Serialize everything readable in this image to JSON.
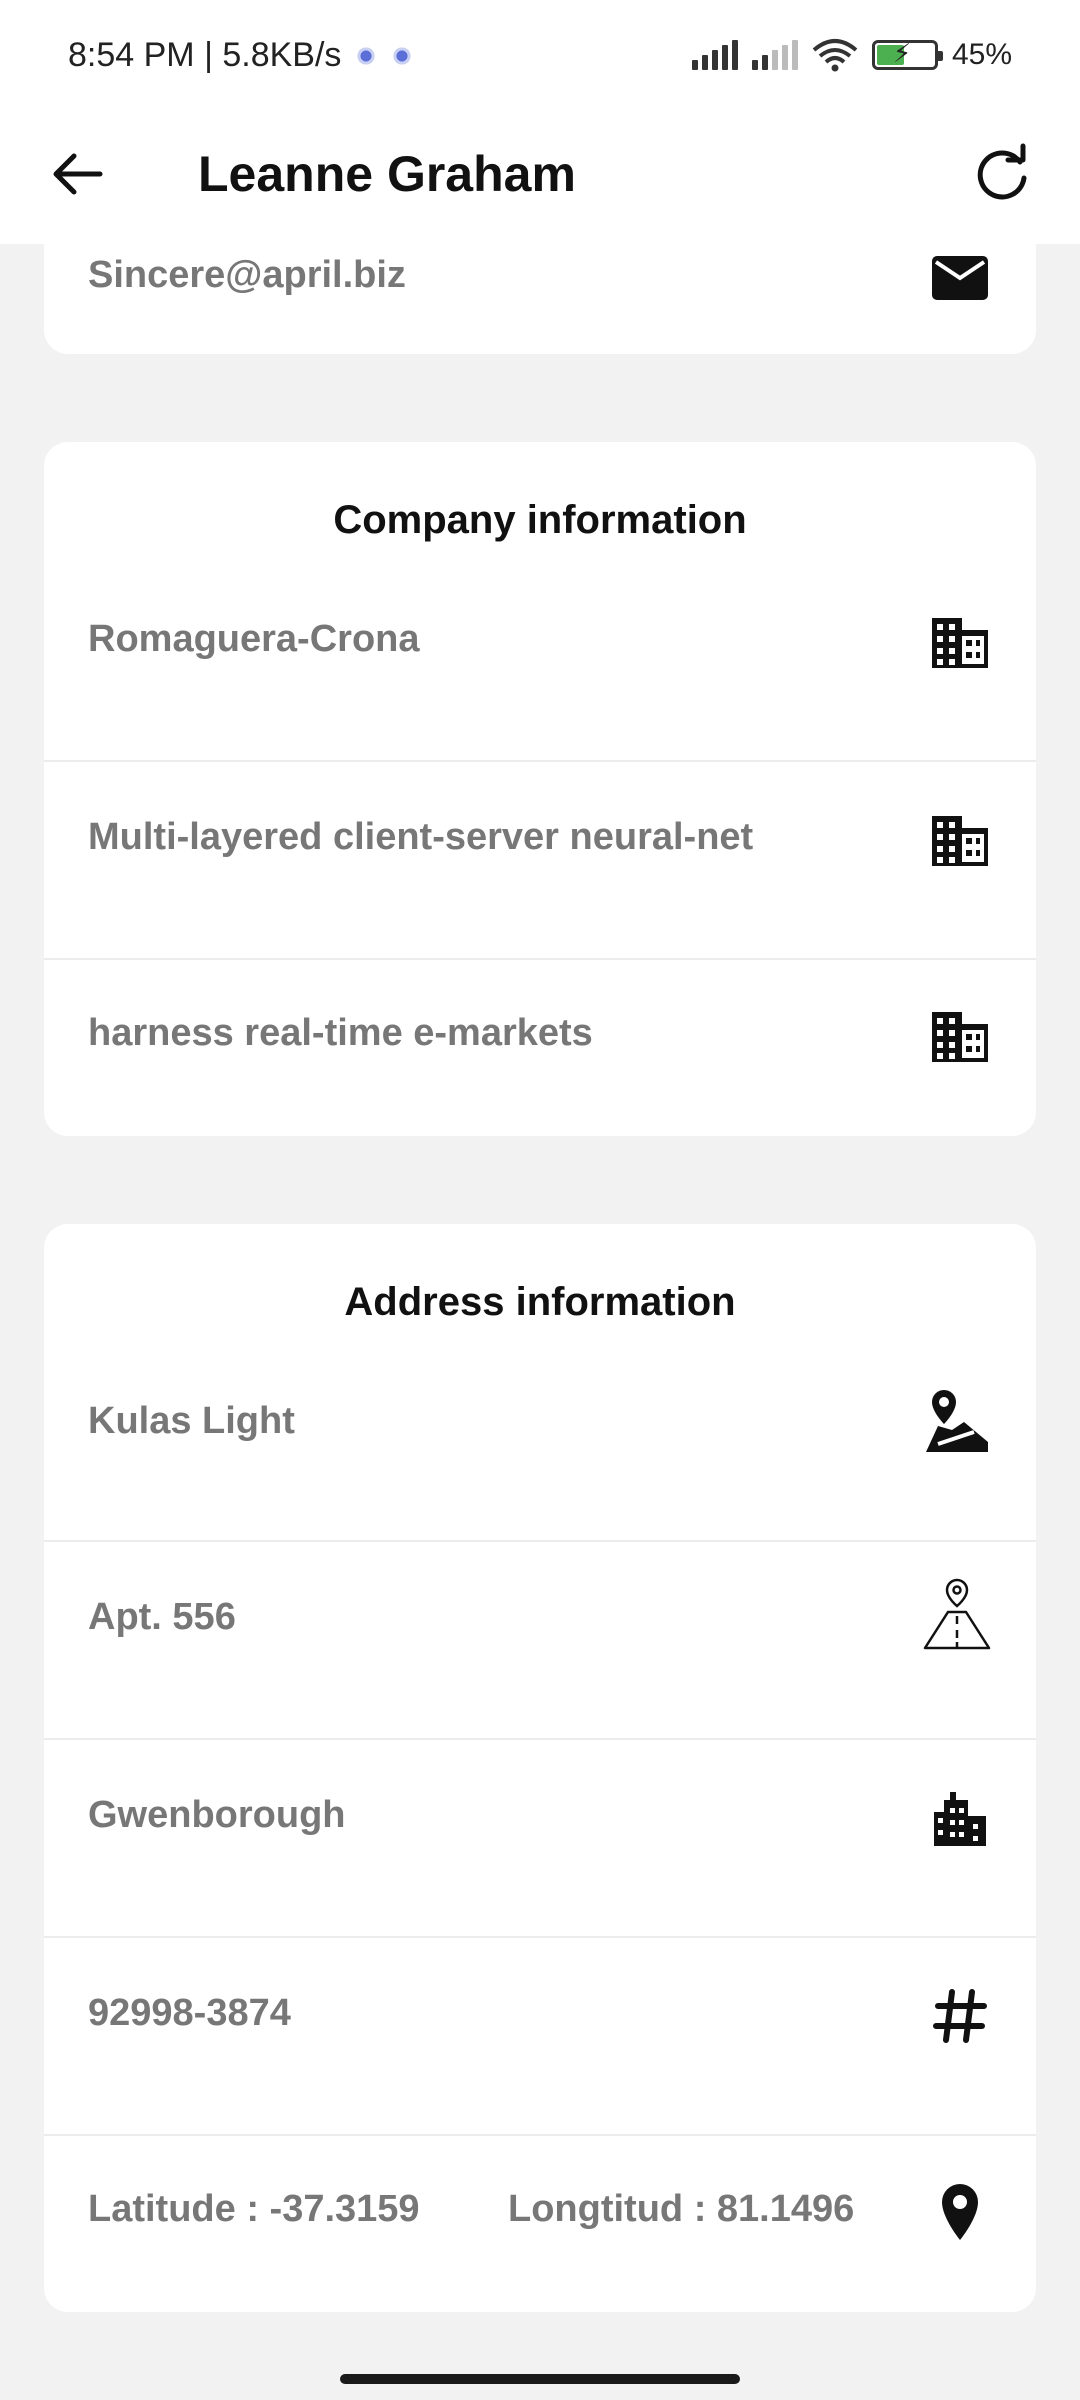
{
  "status_bar": {
    "time_speed": "8:54 PM | 5.8KB/s",
    "battery_level": 0.45,
    "battery_text": "45%"
  },
  "app_bar": {
    "title": "Leanne Graham",
    "back_icon": "arrow-back-icon",
    "refresh_icon": "refresh-icon"
  },
  "contact": {
    "email": "Sincere@april.biz",
    "email_icon": "mail-icon"
  },
  "company": {
    "title": "Company information",
    "name": "Romaguera-Crona",
    "catch_phrase": "Multi-layered client-server neural-net",
    "bs": "harness real-time e-markets",
    "icon": "business-icon"
  },
  "address": {
    "title": "Address information",
    "street": "Kulas Light",
    "suite": "Apt. 556",
    "city": "Gwenborough",
    "zipcode": "92998-3874",
    "latitude_label": "Latitude : -37.3159",
    "longitude_label": "Longtitud : 81.1496",
    "icons": [
      "map-icon",
      "road-icon",
      "city-icon",
      "hash-icon",
      "location-pin-icon"
    ]
  },
  "colors": {
    "background": "#f2f2f2",
    "card": "#ffffff",
    "text_primary": "#111111",
    "text_secondary": "#777777",
    "battery_green": "#4caf50"
  }
}
